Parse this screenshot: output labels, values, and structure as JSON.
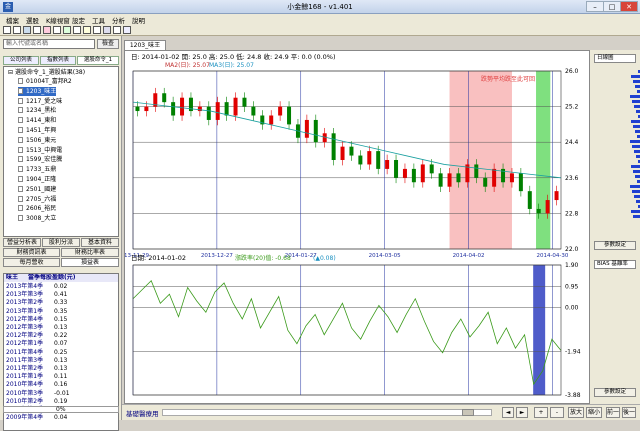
{
  "window": {
    "title": "小金鲸168 - v1.401",
    "min": "–",
    "max": "□",
    "close": "✕"
  },
  "menu": [
    "檔案",
    "選股",
    "K線視窗",
    "設定",
    "工具",
    "分析",
    "說明"
  ],
  "left": {
    "search_placeholder": "輸入代號或名稱",
    "search_button": "檢查",
    "tabs": [
      "公司列表",
      "指數列表",
      "選股命令_1"
    ],
    "tree_root": "選股命令_1_選股結果(38)",
    "tree_items": [
      "01004T_富邦R2",
      "1203_味王",
      "1217_愛之味",
      "1234_黑松",
      "1414_東和",
      "1451_年興",
      "1506_東元",
      "1513_中興電",
      "1599_宏佳騰",
      "1733_五鼎",
      "1904_正隆",
      "2501_國建",
      "2705_六福",
      "2606_裕民",
      "3008_大立"
    ],
    "tree_selected": 1,
    "btn_row1": [
      "營益分析表",
      "股利分派",
      "基本資料"
    ],
    "btn_row2": [
      "財務資訊表",
      "財務比率表"
    ],
    "btn_row3": [
      "每月營收",
      "損益表"
    ],
    "fin_header": [
      "味王",
      "當季每股盈餘(元)"
    ],
    "fin_rows": [
      [
        "2013年第4季",
        "0.02"
      ],
      [
        "2013年第3季",
        "0.41"
      ],
      [
        "2013年第2季",
        "0.33"
      ],
      [
        "2013年第1季",
        "0.35"
      ],
      [
        "2012年第4季",
        "0.15"
      ],
      [
        "2012年第3季",
        "0.13"
      ],
      [
        "2012年第2季",
        "0.22"
      ],
      [
        "2012年第1季",
        "0.07"
      ],
      [
        "2011年第4季",
        "0.25"
      ],
      [
        "2011年第3季",
        "0.13"
      ],
      [
        "2011年第2季",
        "0.13"
      ],
      [
        "2011年第1季",
        "0.11"
      ],
      [
        "2010年第4季",
        "0.16"
      ],
      [
        "2010年第3季",
        "-0.01"
      ],
      [
        "2010年第2季",
        "0.19"
      ],
      [
        "2010年第1季",
        "0.2"
      ],
      [
        "2009年第4季",
        "0.04"
      ]
    ],
    "progress": "0%"
  },
  "chart": {
    "tab": "1203_味王",
    "ohlc_label": "日: 2014-01-02 開: 25.0 高: 25.0 低: 24.8 收: 24.9 平: 0.0 (0.0%)",
    "ma_labels": [
      "MA2(日): 25.07",
      "MA3(日): 25.07"
    ],
    "annotation": "跌勢平均跌至此可回",
    "sub_label": "日期: 2014-01-02",
    "sub_label2": "漲跌率(20)值: -0.68",
    "sub_label3": "(▲0.08)",
    "colors": {
      "up": "#e00000",
      "down": "#008000",
      "ma": "#1aa0a0",
      "osc": "#3a9a1a",
      "shade_red": "#f7b0b0",
      "shade_green": "#7fe07f",
      "shade_blue": "#3040c0"
    }
  },
  "right": {
    "period_select": "日線圖",
    "set_btn": "參數設定",
    "sub_select": "BIAS 基離率",
    "set_btn2": "參數設定"
  },
  "bottom": {
    "label": "基礎醫療用",
    "buttons": [
      "+",
      "-",
      "放大",
      "縮小",
      "前一",
      "後一"
    ],
    "nav": [
      "◄",
      "►"
    ]
  },
  "chart_data": [
    {
      "type": "line",
      "title": "1203_味王 日線",
      "x": [
        "2013-11-29",
        "2013-12-27",
        "2014-01-27",
        "2014-03-05",
        "2014-04-02",
        "2014-04-30"
      ],
      "ylim": [
        22.0,
        26.0
      ],
      "yticks": [
        22.0,
        22.8,
        23.6,
        24.4,
        25.2,
        26.0
      ],
      "series": [
        {
          "name": "MA2(日)",
          "values": [
            25.3,
            25.2,
            25.1,
            24.9,
            24.7,
            24.5,
            24.3,
            24.1,
            23.9,
            23.8,
            23.7,
            23.6
          ]
        }
      ],
      "close": [
        25.1,
        25.2,
        25.5,
        25.3,
        25.0,
        25.4,
        25.1,
        25.2,
        24.9,
        25.3,
        25.0,
        25.4,
        25.2,
        25.0,
        24.8,
        25.0,
        25.2,
        24.8,
        24.5,
        24.9,
        24.4,
        24.6,
        24.0,
        24.3,
        24.1,
        23.9,
        24.2,
        23.8,
        24.0,
        23.6,
        23.8,
        23.5,
        23.9,
        23.7,
        23.4,
        23.7,
        23.5,
        23.9,
        23.6,
        23.4,
        23.8,
        23.5,
        23.7,
        23.3,
        22.9,
        22.8,
        23.1,
        23.3
      ]
    },
    {
      "type": "line",
      "title": "BIAS",
      "ylim": [
        -3.88,
        1.9
      ],
      "yticks": [
        1.9,
        0.95,
        0.0,
        -1.94,
        -3.88
      ],
      "values": [
        0.4,
        0.8,
        1.2,
        0.2,
        0.6,
        -0.4,
        0.9,
        0.3,
        -0.2,
        0.7,
        1.1,
        0.2,
        -0.5,
        0.4,
        -0.9,
        -0.2,
        0.5,
        -1.0,
        -1.6,
        -0.8,
        -0.3,
        -1.2,
        -0.5,
        0.2,
        -0.9,
        -1.4,
        -0.6,
        0.1,
        -0.4,
        -1.1,
        -0.3,
        0.4,
        -0.6,
        -1.5,
        -2.0,
        -1.1,
        -0.5,
        -1.3,
        -0.8,
        -0.2,
        -1.6,
        -0.9,
        -1.8,
        -1.2,
        -3.4,
        -2.8,
        -1.4,
        -1.9
      ]
    }
  ]
}
